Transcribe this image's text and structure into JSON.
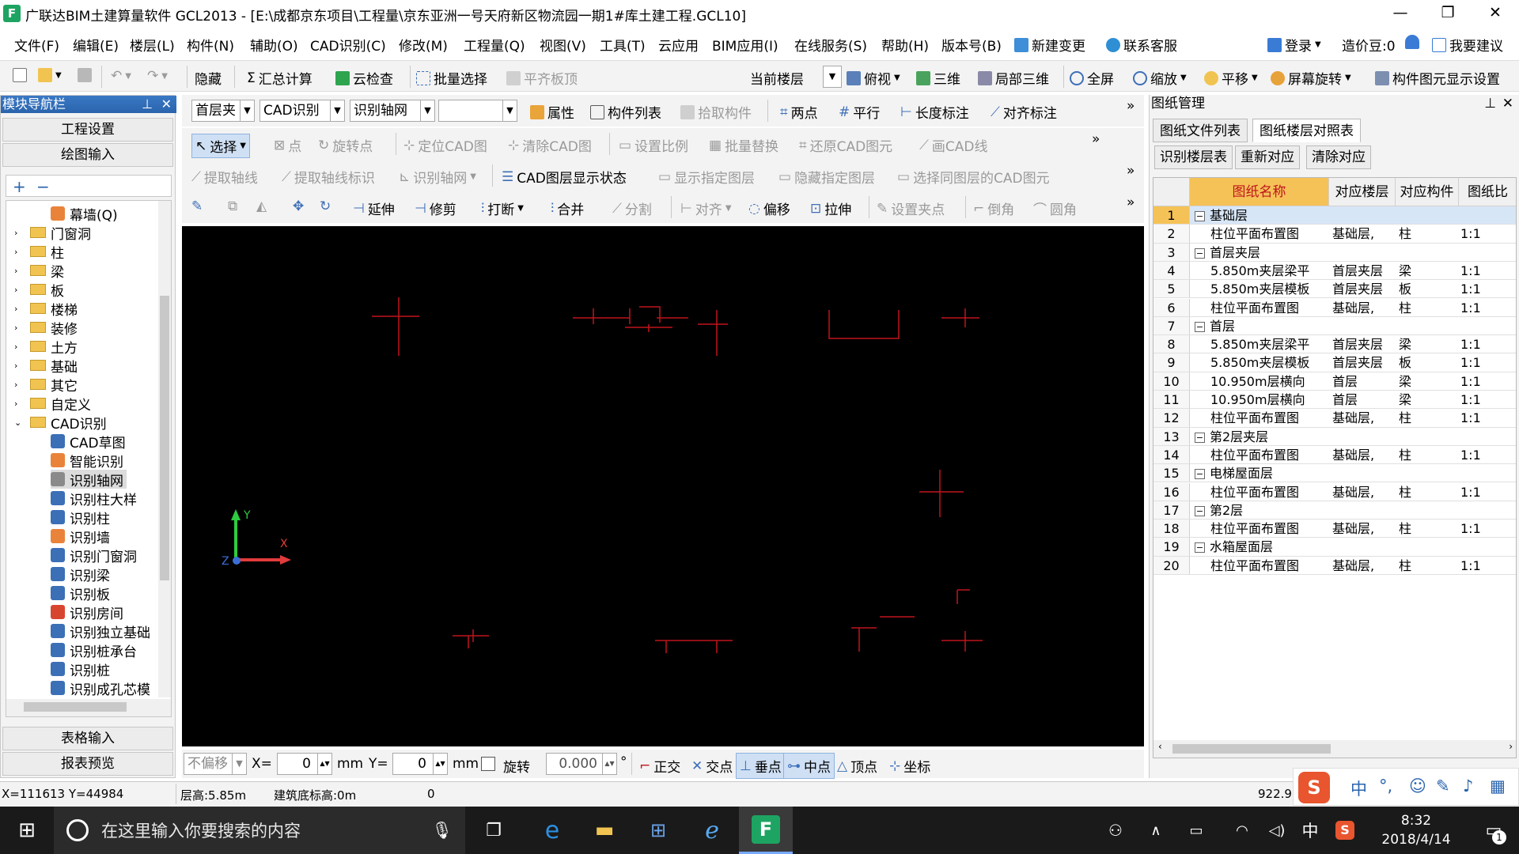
{
  "title_bar": {
    "app_title": "广联达BIM土建算量软件 GCL2013 - [E:\\成都京东项目\\工程量\\京东亚洲一号天府新区物流园一期1#库土建工程.GCL10]",
    "logo": "F",
    "minimize": "—",
    "restore": "❐",
    "close": "✕"
  },
  "menu": {
    "items": [
      "文件(F)",
      "编辑(E)",
      "楼层(L)",
      "构件(N)",
      "辅助(O)",
      "CAD识别(C)",
      "修改(M)",
      "工程量(Q)",
      "视图(V)",
      "工具(T)",
      "云应用",
      "BIM应用(I)",
      "在线服务(S)",
      "帮助(H)",
      "版本号(B)",
      "新建变更",
      "联系客服"
    ],
    "right": {
      "login": "登录",
      "price_beans": "造价豆:0",
      "suggest": "我要建议"
    }
  },
  "toolbar_main": {
    "hide": "隐藏",
    "sum": "汇总计算",
    "cloud_check": "云检查",
    "batch_select": "批量选择",
    "align_slab": "平齐板顶",
    "current_floor": "当前楼层",
    "top_view": "俯视",
    "three_d": "三维",
    "local_3d": "局部三维",
    "fullscreen": "全屏",
    "zoom": "缩放",
    "pan": "平移",
    "screen_rotate": "屏幕旋转",
    "component_display": "构件图元显示设置"
  },
  "left_panel": {
    "header": "模块导航栏",
    "project_settings": "工程设置",
    "drawing_input": "绘图输入",
    "table_input": "表格输入",
    "report_preview": "报表预览",
    "tree": [
      {
        "label": "幕墙(Q)",
        "type": "sub"
      },
      {
        "label": "门窗洞",
        "type": "folder"
      },
      {
        "label": "柱",
        "type": "folder"
      },
      {
        "label": "梁",
        "type": "folder"
      },
      {
        "label": "板",
        "type": "folder"
      },
      {
        "label": "楼梯",
        "type": "folder"
      },
      {
        "label": "装修",
        "type": "folder"
      },
      {
        "label": "土方",
        "type": "folder"
      },
      {
        "label": "基础",
        "type": "folder"
      },
      {
        "label": "其它",
        "type": "folder"
      },
      {
        "label": "自定义",
        "type": "folder"
      },
      {
        "label": "CAD识别",
        "type": "folder-open"
      },
      {
        "label": "CAD草图",
        "type": "sub"
      },
      {
        "label": "智能识别",
        "type": "sub"
      },
      {
        "label": "识别轴网",
        "type": "sub-selected"
      },
      {
        "label": "识别柱大样",
        "type": "sub"
      },
      {
        "label": "识别柱",
        "type": "sub"
      },
      {
        "label": "识别墙",
        "type": "sub"
      },
      {
        "label": "识别门窗洞",
        "type": "sub"
      },
      {
        "label": "识别梁",
        "type": "sub"
      },
      {
        "label": "识别板",
        "type": "sub"
      },
      {
        "label": "识别房间",
        "type": "sub"
      },
      {
        "label": "识别独立基础",
        "type": "sub"
      },
      {
        "label": "识别桩承台",
        "type": "sub"
      },
      {
        "label": "识别桩",
        "type": "sub"
      },
      {
        "label": "识别成孔芯模",
        "type": "sub"
      }
    ]
  },
  "center_toolbars": {
    "row1": {
      "floor_combo": "首层夹",
      "mode_combo": "CAD识别",
      "sub_combo": "识别轴网",
      "empty_combo": "",
      "properties": "属性",
      "component_list": "构件列表",
      "pick_component": "拾取构件",
      "two_points": "两点",
      "parallel": "平行",
      "length_dim": "长度标注",
      "align_dim": "对齐标注",
      "more": "»"
    },
    "row2": {
      "select": "选择",
      "point": "点",
      "rotate_point": "旋转点",
      "locate_cad": "定位CAD图",
      "clear_cad": "清除CAD图",
      "set_scale": "设置比例",
      "batch_replace": "批量替换",
      "restore_cad": "还原CAD图元",
      "draw_cad_line": "画CAD线",
      "more": "»"
    },
    "row3": {
      "extract_axis": "提取轴线",
      "extract_axis_label": "提取轴线标识",
      "identify_axis": "识别轴网",
      "cad_layer_state": "CAD图层显示状态",
      "show_layer": "显示指定图层",
      "hide_layer": "隐藏指定图层",
      "select_same_layer": "选择同图层的CAD图元",
      "more": "»"
    },
    "row4": {
      "extend": "延伸",
      "trim": "修剪",
      "break": "打断",
      "merge": "合并",
      "split": "分割",
      "align": "对齐",
      "offset": "偏移",
      "stretch": "拉伸",
      "set_grip": "设置夹点",
      "chamfer": "倒角",
      "fillet": "圆角",
      "more": "»"
    }
  },
  "canvas": {
    "axis_y": "Y",
    "axis_x": "X",
    "axis_z": "Z"
  },
  "bottom_bar": {
    "no_offset": "不偏移",
    "x_label": "X=",
    "x_value": "0",
    "mm1": "mm",
    "y_label": "Y=",
    "y_value": "0",
    "mm2": "mm",
    "rotate": "旋转",
    "angle_value": "0.000",
    "degree": "°",
    "ortho": "正交",
    "intersection": "交点",
    "perpendicular": "垂点",
    "midpoint": "中点",
    "vertex": "顶点",
    "coordinate": "坐标"
  },
  "right_panel": {
    "header": "图纸管理",
    "tab_files": "图纸文件列表",
    "tab_floor_map": "图纸楼层对照表",
    "btn_identify_floor": "识别楼层表",
    "btn_remap": "重新对应",
    "btn_clear_map": "清除对应",
    "columns": [
      "图纸名称",
      "对应楼层",
      "对应构件",
      "图纸比"
    ],
    "rows": [
      {
        "n": "1",
        "group": true,
        "name": "基础层",
        "floor": "",
        "comp": "",
        "ratio": ""
      },
      {
        "n": "2",
        "group": false,
        "name": "柱位平面布置图",
        "floor": "基础层,",
        "comp": "柱",
        "ratio": "1:1"
      },
      {
        "n": "3",
        "group": true,
        "name": "首层夹层",
        "floor": "",
        "comp": "",
        "ratio": ""
      },
      {
        "n": "4",
        "group": false,
        "name": "5.850m夹层梁平",
        "floor": "首层夹层",
        "comp": "梁",
        "ratio": "1:1"
      },
      {
        "n": "5",
        "group": false,
        "name": "5.850m夹层模板",
        "floor": "首层夹层",
        "comp": "板",
        "ratio": "1:1"
      },
      {
        "n": "6",
        "group": false,
        "name": "柱位平面布置图",
        "floor": "基础层,",
        "comp": "柱",
        "ratio": "1:1"
      },
      {
        "n": "7",
        "group": true,
        "name": "首层",
        "floor": "",
        "comp": "",
        "ratio": ""
      },
      {
        "n": "8",
        "group": false,
        "name": "5.850m夹层梁平",
        "floor": "首层夹层",
        "comp": "梁",
        "ratio": "1:1"
      },
      {
        "n": "9",
        "group": false,
        "name": "5.850m夹层模板",
        "floor": "首层夹层",
        "comp": "板",
        "ratio": "1:1"
      },
      {
        "n": "10",
        "group": false,
        "name": "10.950m层横向",
        "floor": "首层",
        "comp": "梁",
        "ratio": "1:1"
      },
      {
        "n": "11",
        "group": false,
        "name": "10.950m层横向",
        "floor": "首层",
        "comp": "梁",
        "ratio": "1:1"
      },
      {
        "n": "12",
        "group": false,
        "name": "柱位平面布置图",
        "floor": "基础层,",
        "comp": "柱",
        "ratio": "1:1"
      },
      {
        "n": "13",
        "group": true,
        "name": "第2层夹层",
        "floor": "",
        "comp": "",
        "ratio": ""
      },
      {
        "n": "14",
        "group": false,
        "name": "柱位平面布置图",
        "floor": "基础层,",
        "comp": "柱",
        "ratio": "1:1"
      },
      {
        "n": "15",
        "group": true,
        "name": "电梯屋面层",
        "floor": "",
        "comp": "",
        "ratio": ""
      },
      {
        "n": "16",
        "group": false,
        "name": "柱位平面布置图",
        "floor": "基础层,",
        "comp": "柱",
        "ratio": "1:1"
      },
      {
        "n": "17",
        "group": true,
        "name": "第2层",
        "floor": "",
        "comp": "",
        "ratio": ""
      },
      {
        "n": "18",
        "group": false,
        "name": "柱位平面布置图",
        "floor": "基础层,",
        "comp": "柱",
        "ratio": "1:1"
      },
      {
        "n": "19",
        "group": true,
        "name": "水箱屋面层",
        "floor": "",
        "comp": "",
        "ratio": ""
      },
      {
        "n": "20",
        "group": false,
        "name": "柱位平面布置图",
        "floor": "基础层,",
        "comp": "柱",
        "ratio": "1:1"
      }
    ]
  },
  "status_bar": {
    "coords": "X=111613  Y=44984",
    "floor_height": "层高:5.85m",
    "base_elev": "建筑底标高:0m",
    "zero": "0",
    "right_value": "922.9"
  },
  "ime": {
    "lang": "中"
  },
  "taskbar": {
    "search_placeholder": "在这里输入你要搜索的内容",
    "ime_lang": "中",
    "time": "8:32",
    "date": "2018/4/14",
    "notifications": "1"
  },
  "colors": {
    "accent": "#2a64ad",
    "grid_header_highlight": "#f5c257",
    "canvas_bg": "#000000",
    "cad_line": "#c0141c"
  }
}
